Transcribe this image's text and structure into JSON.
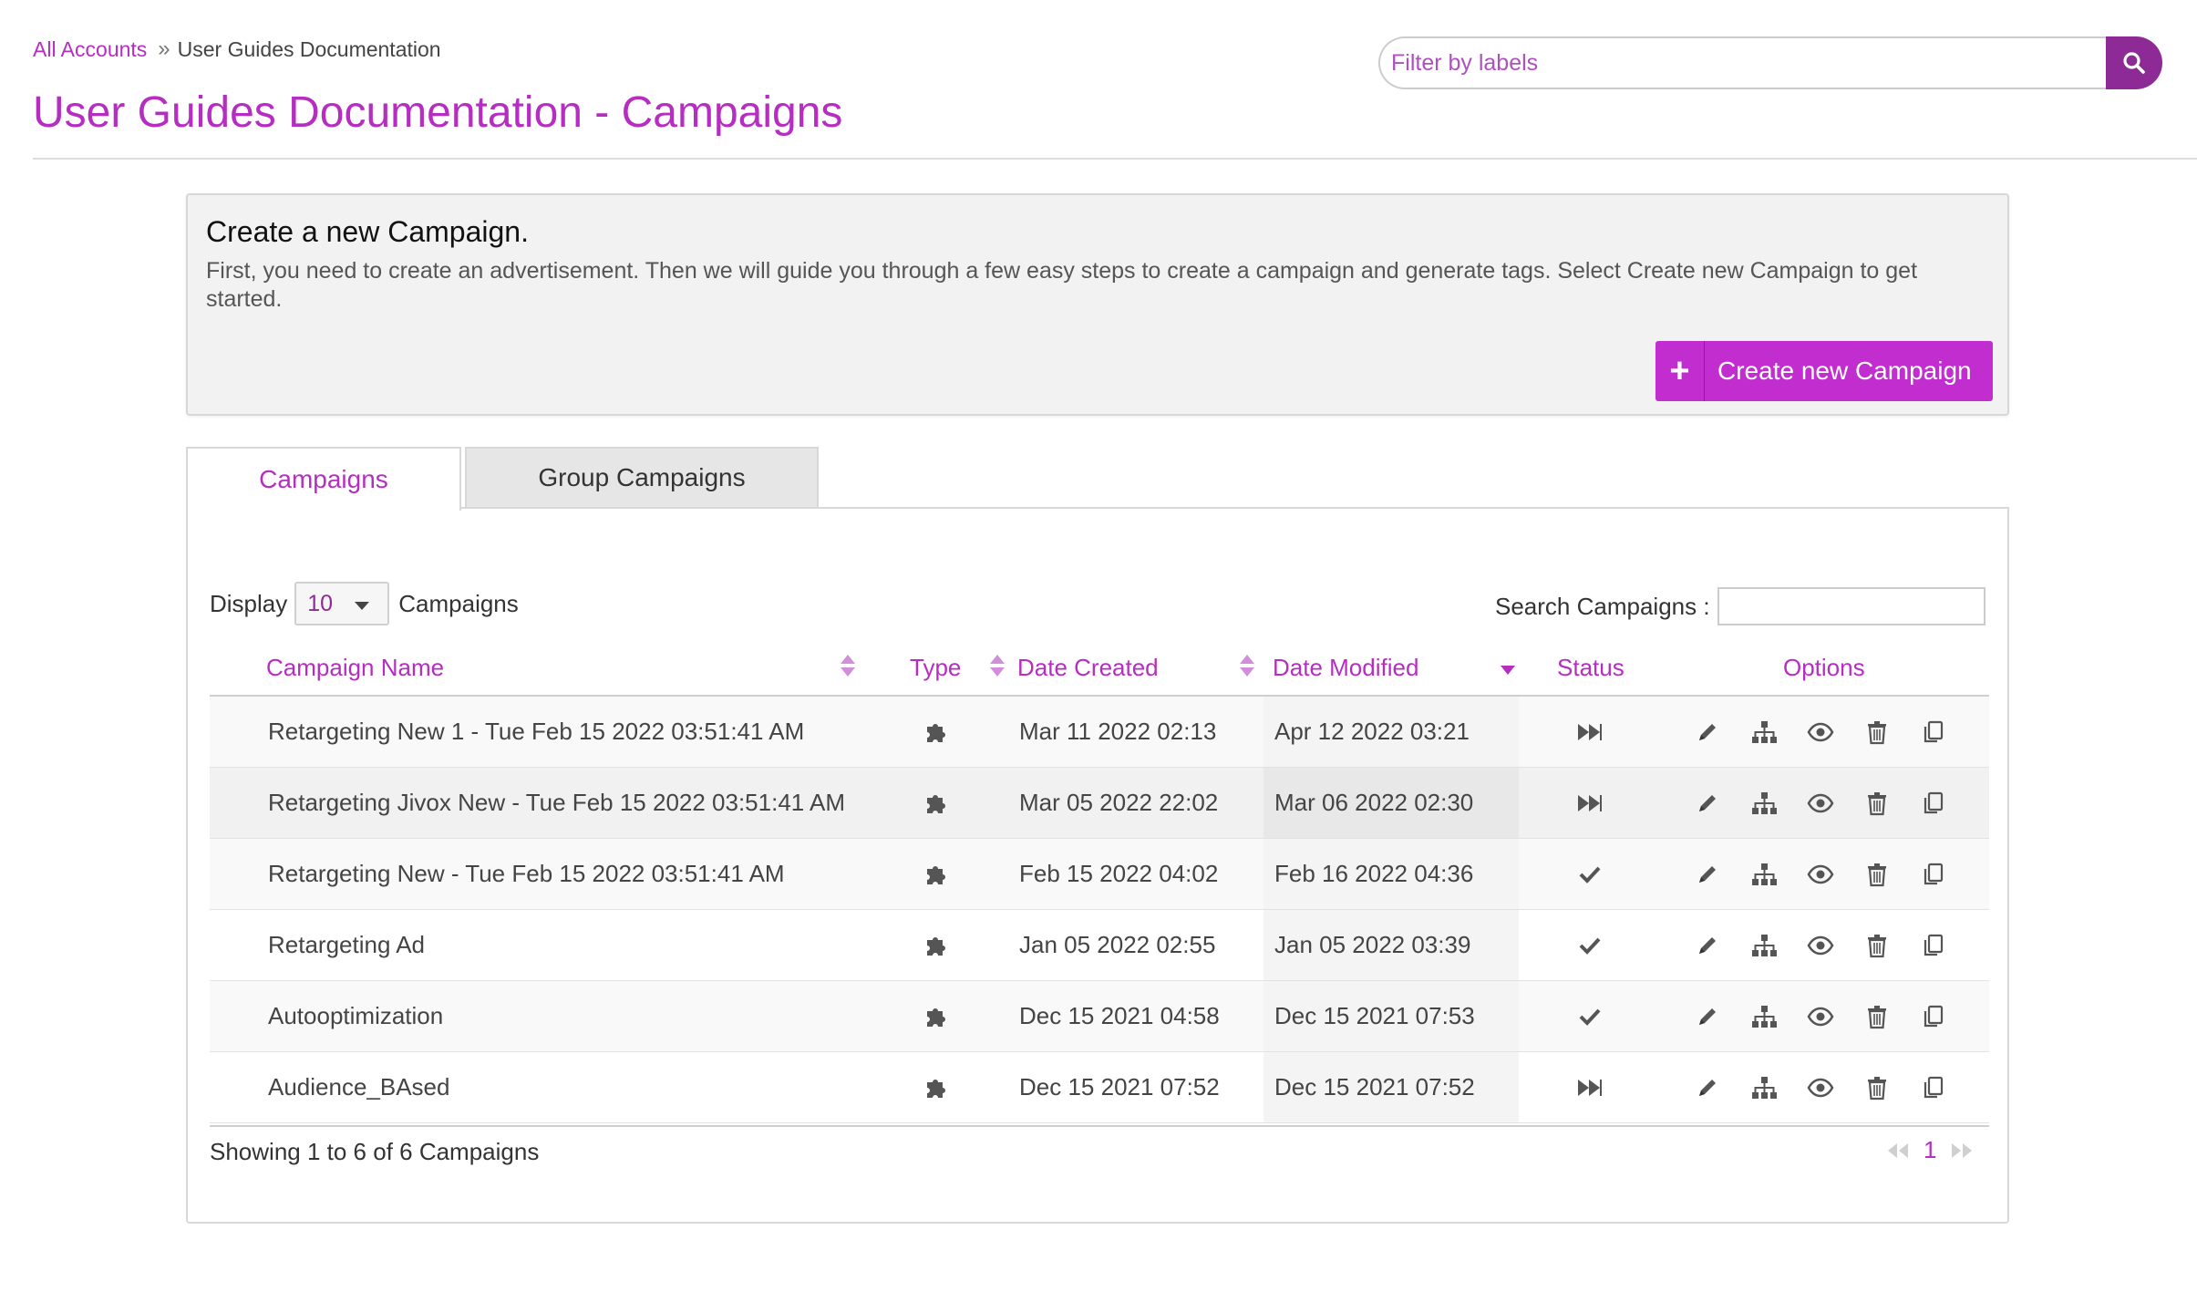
{
  "breadcrumb": {
    "root": "All Accounts",
    "separator": "»",
    "current": "User Guides Documentation"
  },
  "page_title": "User Guides Documentation - Campaigns",
  "filter": {
    "placeholder": "Filter by labels",
    "value": "",
    "button_icon": "search-icon"
  },
  "create_panel": {
    "title": "Create a new Campaign.",
    "description": "First, you need to create an advertisement. Then we will guide you through a few easy steps to create a campaign and generate tags. Select Create new Campaign to get started.",
    "button_label": "Create new Campaign",
    "button_icon": "plus-icon"
  },
  "tabs": [
    {
      "label": "Campaigns",
      "active": true
    },
    {
      "label": "Group Campaigns",
      "active": false
    }
  ],
  "table_controls": {
    "display_label": "Display",
    "display_value": "10",
    "display_suffix": "Campaigns",
    "search_label": "Search Campaigns :",
    "search_value": ""
  },
  "columns": {
    "name": "Campaign Name",
    "type": "Type",
    "created": "Date Created",
    "modified": "Date Modified",
    "status": "Status",
    "options": "Options"
  },
  "rows": [
    {
      "name": "Retargeting New 1 - Tue Feb 15 2022 03:51:41 AM",
      "type_icon": "puzzle-icon",
      "created": "Mar 11 2022 02:13",
      "modified": "Apr 12 2022 03:21",
      "status_icon": "fast-forward-icon"
    },
    {
      "name": "Retargeting Jivox New - Tue Feb 15 2022 03:51:41 AM",
      "type_icon": "puzzle-icon",
      "created": "Mar 05 2022 22:02",
      "modified": "Mar 06 2022 02:30",
      "status_icon": "fast-forward-icon"
    },
    {
      "name": "Retargeting New - Tue Feb 15 2022 03:51:41 AM",
      "type_icon": "puzzle-icon",
      "created": "Feb 15 2022 04:02",
      "modified": "Feb 16 2022 04:36",
      "status_icon": "checkmark-icon"
    },
    {
      "name": "Retargeting Ad",
      "type_icon": "puzzle-icon",
      "created": "Jan 05 2022 02:55",
      "modified": "Jan 05 2022 03:39",
      "status_icon": "checkmark-icon"
    },
    {
      "name": "Autooptimization",
      "type_icon": "puzzle-icon",
      "created": "Dec 15 2021 04:58",
      "modified": "Dec 15 2021 07:53",
      "status_icon": "checkmark-icon"
    },
    {
      "name": "Audience_BAsed",
      "type_icon": "puzzle-icon",
      "created": "Dec 15 2021 07:52",
      "modified": "Dec 15 2021 07:52",
      "status_icon": "fast-forward-icon"
    }
  ],
  "row_options": [
    "edit-pencil-icon",
    "hierarchy-icon",
    "eye-icon",
    "trash-icon",
    "copy-icon"
  ],
  "footer": {
    "showing": "Showing 1 to 6 of 6 Campaigns",
    "current_page": "1"
  },
  "colors": {
    "accent": "#b62ec1",
    "button": "#c12dcf",
    "search_button": "#8e2a96",
    "panel_bg": "#f2f2f2"
  }
}
